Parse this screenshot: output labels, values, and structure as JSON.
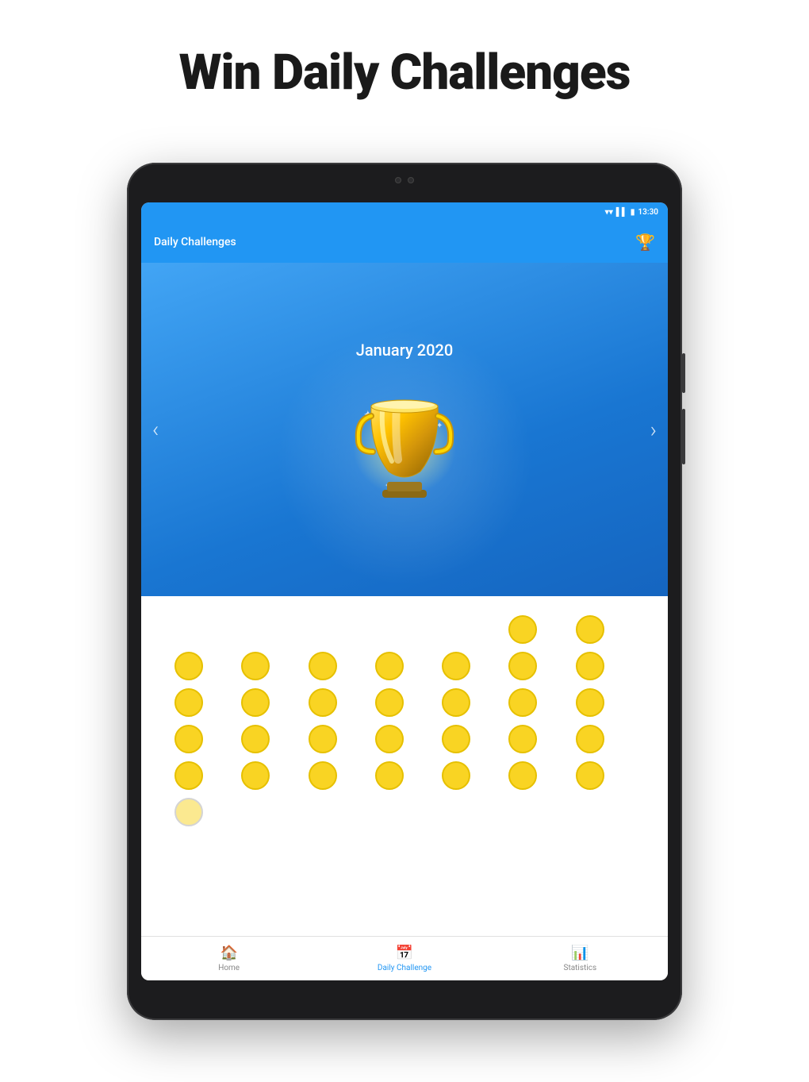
{
  "page": {
    "title": "Win Daily Challenges"
  },
  "app": {
    "bar_title": "Daily Challenges",
    "trophy_icon": "🏆",
    "status_time": "13:30",
    "hero_month": "January 2020",
    "nav_left": "‹",
    "nav_right": "›"
  },
  "dots": {
    "rows": [
      [
        false,
        false,
        false,
        false,
        false,
        true,
        true
      ],
      [
        true,
        true,
        true,
        true,
        true,
        true,
        true
      ],
      [
        true,
        true,
        true,
        true,
        true,
        true,
        true
      ],
      [
        true,
        true,
        true,
        true,
        true,
        true,
        true
      ],
      [
        true,
        true,
        true,
        true,
        true,
        true,
        true
      ],
      [
        "today",
        false,
        false,
        false,
        false,
        false,
        false
      ]
    ]
  },
  "bottom_nav": {
    "items": [
      {
        "label": "Home",
        "icon": "🏠",
        "active": false
      },
      {
        "label": "Daily Challenge",
        "icon": "📅",
        "active": true
      },
      {
        "label": "Statistics",
        "icon": "📊",
        "active": false
      }
    ]
  }
}
